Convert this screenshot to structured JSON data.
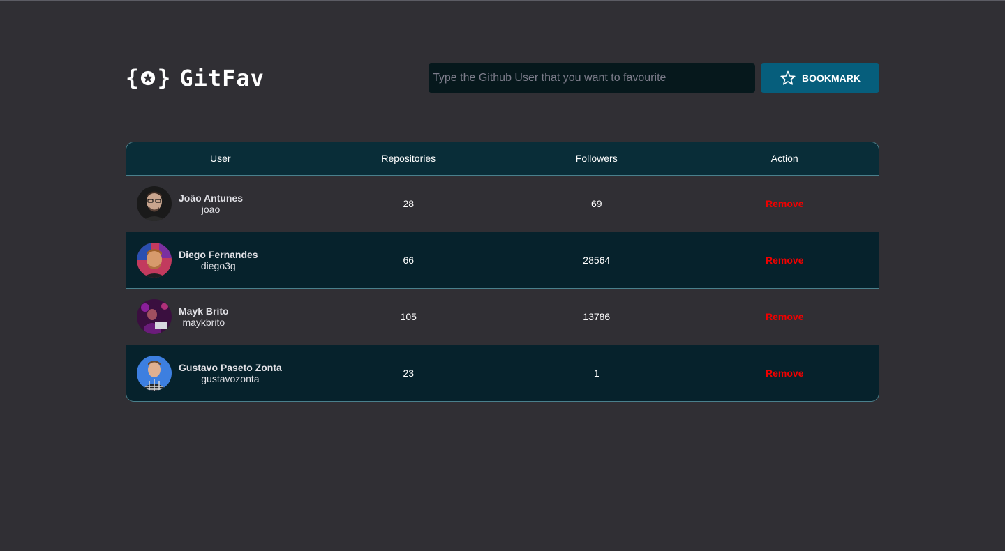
{
  "app": {
    "name": "GitFav",
    "logo_mark_left": "{",
    "logo_mark_right": "}"
  },
  "search": {
    "placeholder": "Type the Github User that you want to favourite",
    "value": "",
    "button_label": "BOOKMARK"
  },
  "table": {
    "headers": [
      "User",
      "Repositories",
      "Followers",
      "Action"
    ],
    "rows": [
      {
        "name": "João Antunes",
        "login": "joao",
        "repositories": "28",
        "followers": "69",
        "action": "Remove"
      },
      {
        "name": "Diego Fernandes",
        "login": "diego3g",
        "repositories": "66",
        "followers": "28564",
        "action": "Remove"
      },
      {
        "name": "Mayk Brito",
        "login": "maykbrito",
        "repositories": "105",
        "followers": "13786",
        "action": "Remove"
      },
      {
        "name": "Gustavo Paseto Zonta",
        "login": "gustavozonta",
        "repositories": "23",
        "followers": "1",
        "action": "Remove"
      }
    ]
  },
  "colors": {
    "background": "#302f34",
    "header_row": "#092d38",
    "even_row": "#06222c",
    "accent_button": "#065e7c",
    "danger": "#f00000",
    "border": "#4a808c"
  },
  "icons": {
    "logo": "star-braces-icon",
    "bookmark": "star-outline-icon",
    "avatar": "user-photo-avatar"
  }
}
